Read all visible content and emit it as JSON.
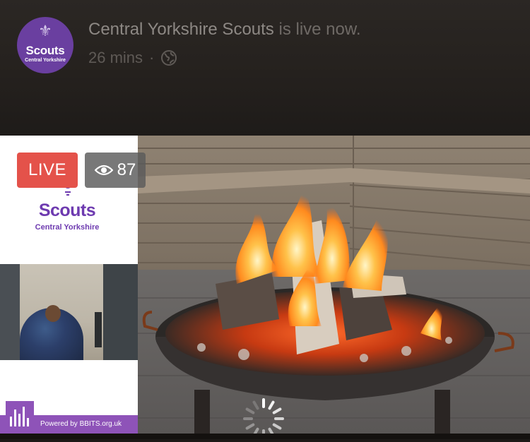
{
  "header": {
    "page_name": "Central Yorkshire Scouts",
    "status_text": "is live now.",
    "time_ago": "26 mins",
    "separator": "·",
    "privacy_icon": "globe-icon",
    "avatar": {
      "brand": "Scouts",
      "sub": "Central Yorkshire"
    }
  },
  "video": {
    "live_label": "LIVE",
    "viewer_icon": "eye-icon",
    "viewer_count": "87",
    "loading_icon": "spinner-icon",
    "overlay": {
      "logo_text": "Scouts",
      "logo_sub": "Central Yorkshire",
      "powered_by": "Powered by BBITS.org.uk"
    }
  },
  "colors": {
    "live_red": "#e4524a",
    "scouts_purple": "#6e3bb0",
    "bbits_purple": "#8e53b8"
  }
}
